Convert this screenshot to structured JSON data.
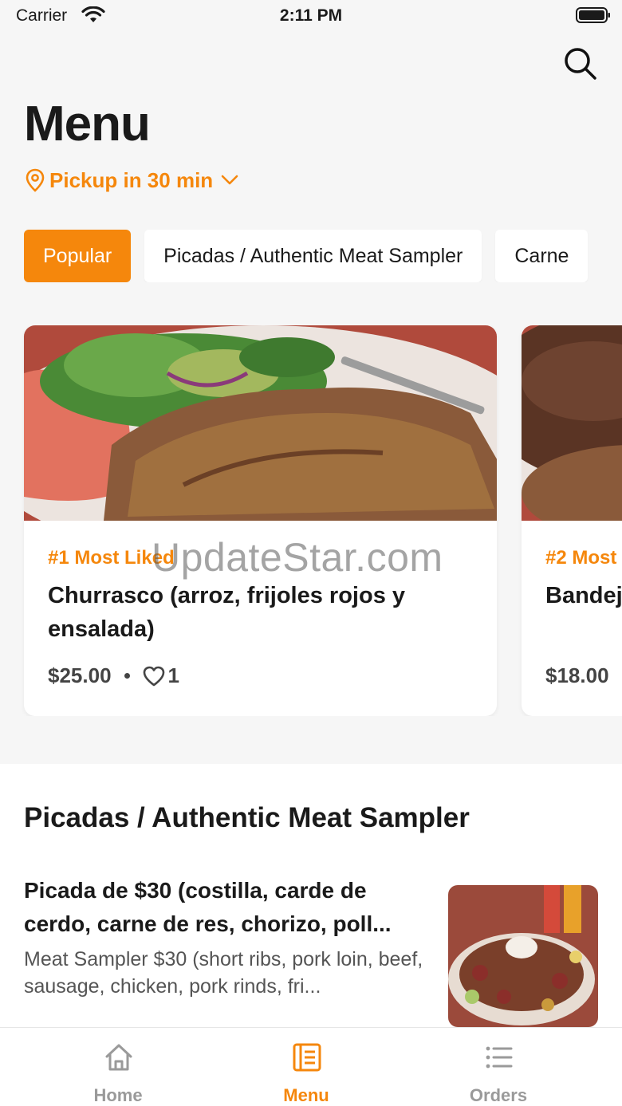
{
  "status_bar": {
    "carrier": "Carrier",
    "time": "2:11 PM"
  },
  "header": {
    "title": "Menu",
    "pickup_label": "Pickup in 30 min",
    "search_icon": "search-icon"
  },
  "categories": [
    {
      "label": "Popular",
      "active": true
    },
    {
      "label": "Picadas / Authentic Meat Sampler",
      "active": false
    },
    {
      "label": "Carne",
      "active": false
    }
  ],
  "popular": [
    {
      "rank": "#1 Most Liked",
      "name": "Churrasco (arroz, frijoles rojos y ensalada)",
      "price": "$25.00",
      "likes": "1"
    },
    {
      "rank": "#2 Most",
      "name": "Bandej frijoles",
      "price": "$18.00"
    }
  ],
  "section": {
    "title": "Picadas / Authentic Meat Sampler",
    "item": {
      "name": "Picada de $30 (costilla, carde de cerdo, carne de res, chorizo, poll...",
      "description": "Meat Sampler $30 (short ribs, pork loin, beef, sausage, chicken, pork rinds, fri..."
    }
  },
  "watermark": "UpdateStar.com",
  "tabs": [
    {
      "label": "Home",
      "icon": "home-icon"
    },
    {
      "label": "Menu",
      "icon": "menu-book-icon",
      "active": true
    },
    {
      "label": "Orders",
      "icon": "list-icon"
    }
  ],
  "colors": {
    "accent": "#f5870c",
    "background": "#f6f6f6",
    "inactive_tab": "#9a9a9a"
  }
}
